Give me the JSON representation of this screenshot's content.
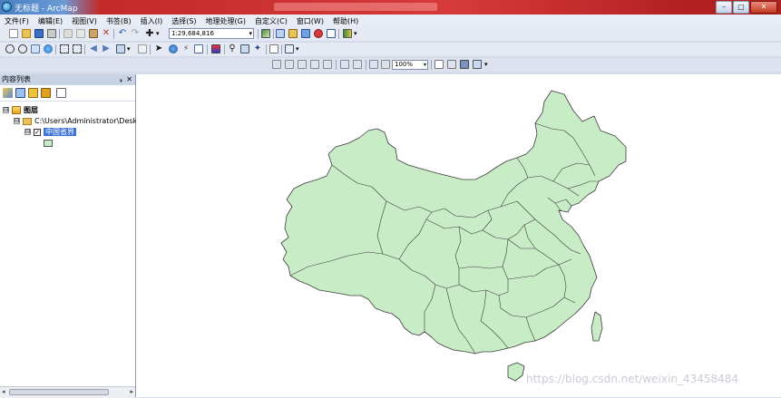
{
  "window": {
    "title": "无标题 - ArcMap",
    "min_glyph": "–",
    "max_glyph": "□",
    "close_glyph": "✕"
  },
  "menu": [
    "文件(F)",
    "编辑(E)",
    "视图(V)",
    "书签(B)",
    "插入(I)",
    "选择(S)",
    "地理处理(G)",
    "自定义(C)",
    "窗口(W)",
    "帮助(H)"
  ],
  "toolbar": {
    "scale_value": "1:29,684,816",
    "zoom_value": "100%",
    "dropdown_glyph": "▾"
  },
  "toc": {
    "title": "内容列表",
    "pin_glyph": "ᵩ",
    "close_glyph": "✕",
    "root_label": "图层",
    "folder_label": "C:\\Users\\Administrator\\Desk",
    "layer_label": "中国省界",
    "expander_glyph": "⊟",
    "check_glyph": "✓",
    "scroll_left": "◂",
    "scroll_right": "▸",
    "scroll_grip": "III"
  },
  "map": {
    "layer_fill": "#c8ecc6",
    "layer_stroke": "#3c3c3c"
  },
  "watermark": "https://blog.csdn.net/weixin_43458484",
  "colors": {
    "title_bar": "#c22a2a",
    "selection": "#3b73d6",
    "panel_bg": "#d6dbe9"
  }
}
